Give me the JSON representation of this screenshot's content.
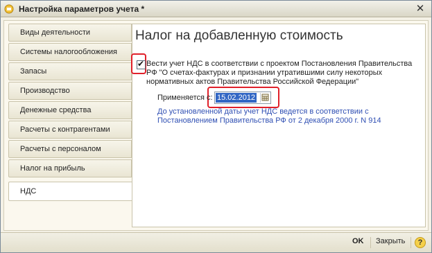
{
  "window": {
    "title": "Настройка параметров учета *",
    "close_icon": "close-icon"
  },
  "tabs": [
    {
      "label": "Виды деятельности",
      "active": false
    },
    {
      "label": "Системы налогообложения",
      "active": false
    },
    {
      "label": "Запасы",
      "active": false
    },
    {
      "label": "Производство",
      "active": false
    },
    {
      "label": "Денежные средства",
      "active": false
    },
    {
      "label": "Расчеты с контрагентами",
      "active": false
    },
    {
      "label": "Расчеты с персоналом",
      "active": false
    },
    {
      "label": "Налог на прибыль",
      "active": false
    },
    {
      "label": "НДС",
      "active": true
    }
  ],
  "panel": {
    "title": "Налог на добавленную стоимость",
    "checkbox": {
      "checked": true,
      "label": "Вести учет НДС в соответствии с проектом Постановления Правительства РФ \"О счетах-фактурах и признании утратившими силу некоторых нормативных актов Правительства Российской Федерации\""
    },
    "applied_from": {
      "label": "Применяется с:",
      "value": "15.02.2012"
    },
    "note": "До установленной даты учет НДС ведется в соответствии с Постановлением Правительства РФ от 2 декабря 2000 г. N 914"
  },
  "footer": {
    "ok_label": "OK",
    "close_label": "Закрыть",
    "help_label": "?"
  },
  "colors": {
    "highlight": "#e0202a",
    "link_text": "#2f4fb3",
    "selection": "#3166c4"
  }
}
